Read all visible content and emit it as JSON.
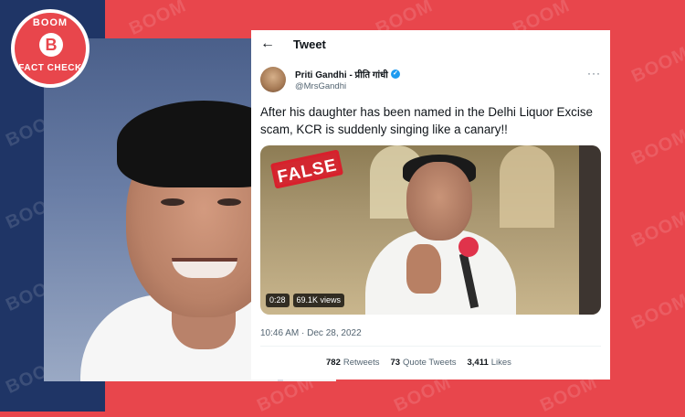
{
  "brand": {
    "logo_top": "BOOM",
    "logo_letter": "B",
    "logo_bottom": "FACT CHECK",
    "watermark": "BOOM",
    "accent_red": "#e8464c",
    "navy": "#1f3566"
  },
  "tweet": {
    "header_title": "Tweet",
    "author_name": "Priti Gandhi - प्रीति गांधी",
    "author_handle": "@MrsGandhi",
    "text": "After his daughter has been named in the Delhi Liquor Excise scam, KCR is suddenly singing like a canary!!",
    "stamp": "FALSE",
    "video_duration": "0:28",
    "video_views": "69.1K views",
    "timestamp": "10:46 AM · Dec 28, 2022",
    "stats": {
      "retweets_count": "782",
      "retweets_label": "Retweets",
      "quotes_count": "73",
      "quotes_label": "Quote Tweets",
      "likes_count": "3,411",
      "likes_label": "Likes"
    }
  },
  "icons": {
    "back": "back-arrow-icon",
    "verified": "verified-badge-icon",
    "more": "more-icon"
  }
}
